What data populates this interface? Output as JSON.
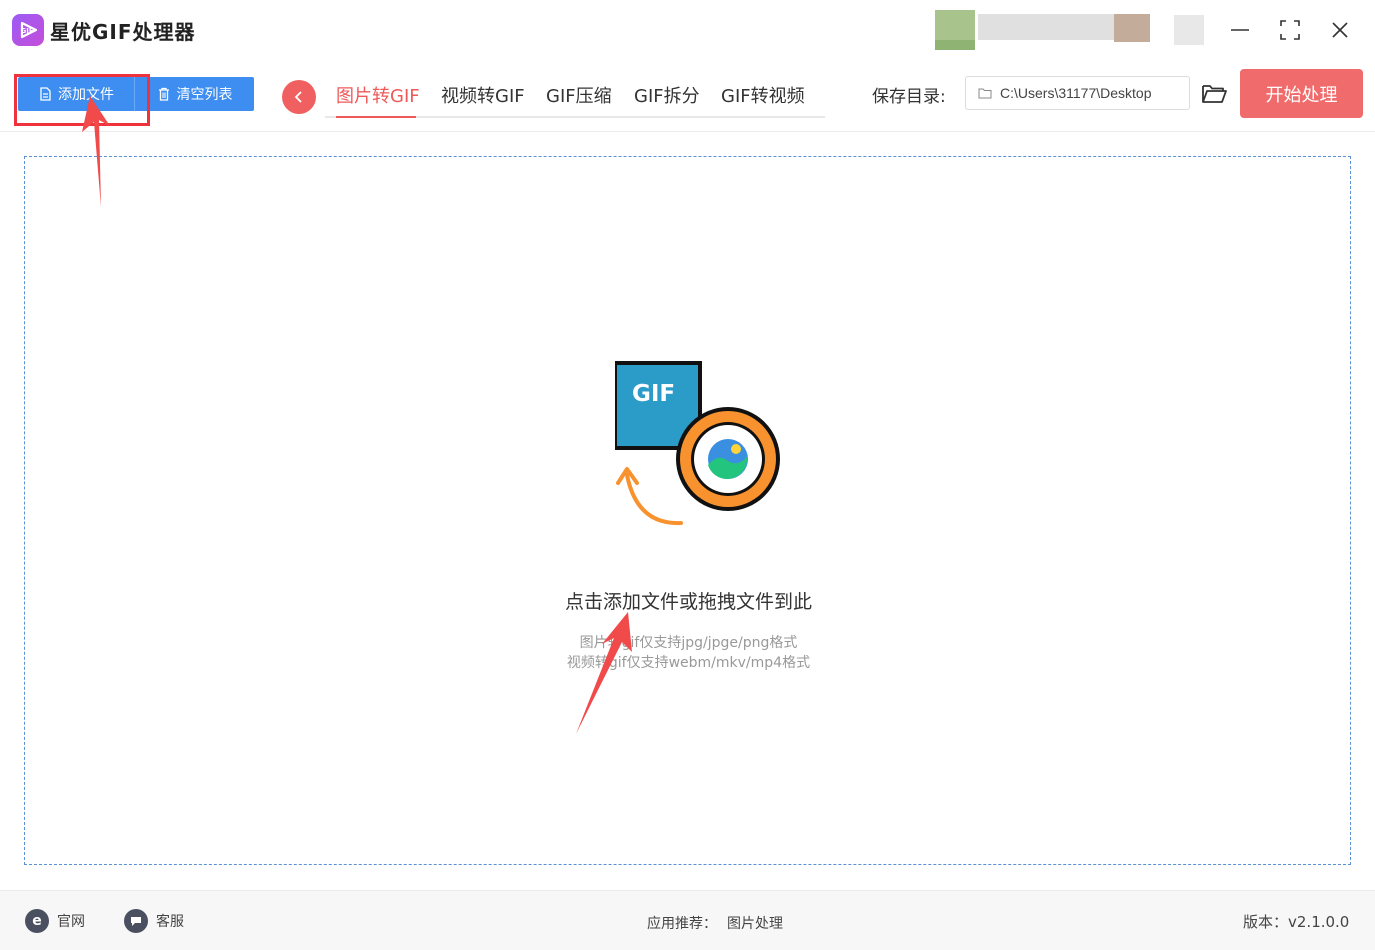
{
  "app": {
    "title": "星优GIF处理器"
  },
  "toolbar": {
    "add_file_label": "添加文件",
    "clear_list_label": "清空列表",
    "tabs": [
      {
        "label": "图片转GIF",
        "active": true
      },
      {
        "label": "视频转GIF",
        "active": false
      },
      {
        "label": "GIF压缩",
        "active": false
      },
      {
        "label": "GIF拆分",
        "active": false
      },
      {
        "label": "GIF转视频",
        "active": false
      }
    ],
    "save_dir_label": "保存目录:",
    "save_dir_value": "C:\\Users\\31177\\Desktop",
    "start_label": "开始处理"
  },
  "dropzone": {
    "illustration_text": "GIF",
    "main_text": "点击添加文件或拖拽文件到此",
    "hint_1": "图片转gif仅支持jpg/jpge/png格式",
    "hint_2": "视频转gif仅支持webm/mkv/mp4格式"
  },
  "footer": {
    "website_label": "官网",
    "support_label": "客服",
    "recommend_label": "应用推荐：",
    "recommend_link": "图片处理",
    "version_label": "版本：v2.1.0.0"
  },
  "colors": {
    "primary_blue": "#3d8ef0",
    "accent_red": "#f06b6b",
    "annotation_red": "#f0323c"
  }
}
